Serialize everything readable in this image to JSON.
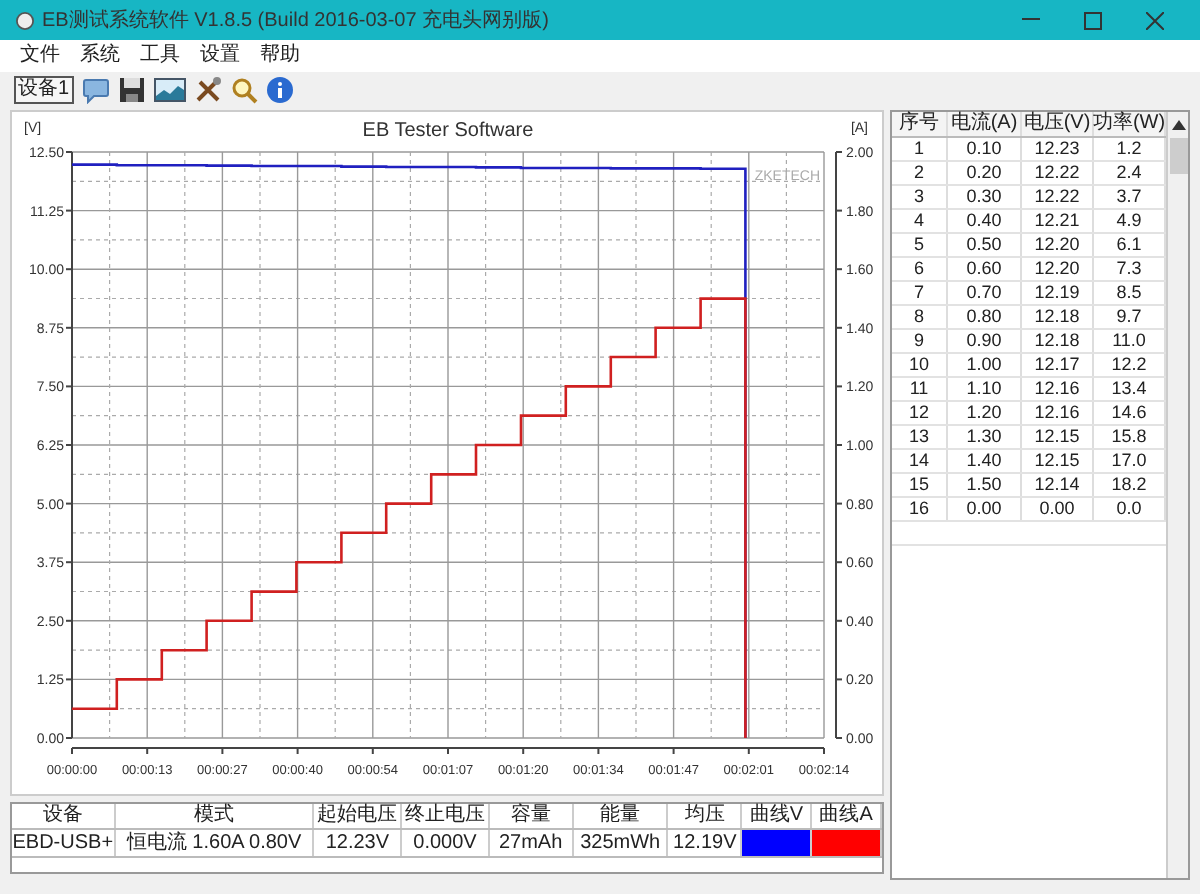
{
  "window": {
    "title": "EB测试系统软件 V1.8.5 (Build 2016-03-07 充电头网别版)"
  },
  "menu": [
    "文件",
    "系统",
    "工具",
    "设置",
    "帮助"
  ],
  "toolbar": {
    "device_button": "设备1"
  },
  "chart": {
    "chart_data": {
      "type": "line",
      "title": "EB Tester Software",
      "ylabel": "[V]",
      "y2label": "[A]",
      "x": [
        0,
        8,
        8,
        16,
        16,
        24,
        24,
        32,
        32,
        40,
        40,
        48,
        48,
        56,
        56,
        64,
        64,
        72,
        72,
        80,
        80,
        88,
        88,
        96,
        96,
        104,
        104,
        112,
        112,
        120,
        120
      ],
      "grid": true,
      "xlim": [
        0,
        134
      ],
      "ylim": [
        0,
        12.5
      ],
      "y2lim": [
        0,
        2
      ],
      "xticks": [
        {
          "value": 0,
          "label": "00:00:00"
        },
        {
          "value": 13.4,
          "label": "00:00:13"
        },
        {
          "value": 26.8,
          "label": "00:00:27"
        },
        {
          "value": 40.2,
          "label": "00:00:40"
        },
        {
          "value": 53.6,
          "label": "00:00:54"
        },
        {
          "value": 67,
          "label": "00:01:07"
        },
        {
          "value": 80.4,
          "label": "00:01:20"
        },
        {
          "value": 93.8,
          "label": "00:01:34"
        },
        {
          "value": 107.2,
          "label": "00:01:47"
        },
        {
          "value": 120.6,
          "label": "00:02:01"
        },
        {
          "value": 134,
          "label": "00:02:14"
        }
      ],
      "yticks": [
        {
          "value": 0,
          "label": "0.00"
        },
        {
          "value": 1.25,
          "label": "1.25"
        },
        {
          "value": 2.5,
          "label": "2.50"
        },
        {
          "value": 3.75,
          "label": "3.75"
        },
        {
          "value": 5,
          "label": "5.00"
        },
        {
          "value": 6.25,
          "label": "6.25"
        },
        {
          "value": 7.5,
          "label": "7.50"
        },
        {
          "value": 8.75,
          "label": "8.75"
        },
        {
          "value": 10,
          "label": "10.00"
        },
        {
          "value": 11.25,
          "label": "11.25"
        },
        {
          "value": 12.5,
          "label": "12.50"
        }
      ],
      "y2ticks": [
        {
          "value": 0,
          "label": "0.00"
        },
        {
          "value": 0.2,
          "label": "0.20"
        },
        {
          "value": 0.4,
          "label": "0.40"
        },
        {
          "value": 0.6,
          "label": "0.60"
        },
        {
          "value": 0.8,
          "label": "0.80"
        },
        {
          "value": 1,
          "label": "1.00"
        },
        {
          "value": 1.2,
          "label": "1.20"
        },
        {
          "value": 1.4,
          "label": "1.40"
        },
        {
          "value": 1.6,
          "label": "1.60"
        },
        {
          "value": 1.8,
          "label": "1.80"
        },
        {
          "value": 2,
          "label": "2.00"
        }
      ],
      "series": [
        {
          "axis": "y",
          "color": "#2020c0",
          "values": [
            12.23,
            12.23,
            12.22,
            12.22,
            12.22,
            12.22,
            12.21,
            12.21,
            12.2,
            12.2,
            12.2,
            12.2,
            12.19,
            12.19,
            12.18,
            12.18,
            12.18,
            12.18,
            12.17,
            12.17,
            12.16,
            12.16,
            12.16,
            12.16,
            12.15,
            12.15,
            12.15,
            12.15,
            12.14,
            12.14,
            0
          ]
        },
        {
          "axis": "y2",
          "color": "#d02020",
          "values": [
            0.1,
            0.1,
            0.2,
            0.2,
            0.3,
            0.3,
            0.4,
            0.4,
            0.5,
            0.5,
            0.6,
            0.6,
            0.7,
            0.7,
            0.8,
            0.8,
            0.9,
            0.9,
            1.0,
            1.0,
            1.1,
            1.1,
            1.2,
            1.2,
            1.3,
            1.3,
            1.4,
            1.4,
            1.5,
            1.5,
            0
          ]
        }
      ],
      "annotations": [
        {
          "text": "ZKETECH"
        }
      ]
    }
  },
  "readings_table": {
    "columns": [
      "序号",
      "电流(A)",
      "电压(V)",
      "功率(W)"
    ],
    "rows": [
      [
        "1",
        "0.10",
        "12.23",
        "1.2"
      ],
      [
        "2",
        "0.20",
        "12.22",
        "2.4"
      ],
      [
        "3",
        "0.30",
        "12.22",
        "3.7"
      ],
      [
        "4",
        "0.40",
        "12.21",
        "4.9"
      ],
      [
        "5",
        "0.50",
        "12.20",
        "6.1"
      ],
      [
        "6",
        "0.60",
        "12.20",
        "7.3"
      ],
      [
        "7",
        "0.70",
        "12.19",
        "8.5"
      ],
      [
        "8",
        "0.80",
        "12.18",
        "9.7"
      ],
      [
        "9",
        "0.90",
        "12.18",
        "11.0"
      ],
      [
        "10",
        "1.00",
        "12.17",
        "12.2"
      ],
      [
        "11",
        "1.10",
        "12.16",
        "13.4"
      ],
      [
        "12",
        "1.20",
        "12.16",
        "14.6"
      ],
      [
        "13",
        "1.30",
        "12.15",
        "15.8"
      ],
      [
        "14",
        "1.40",
        "12.15",
        "17.0"
      ],
      [
        "15",
        "1.50",
        "12.14",
        "18.2"
      ],
      [
        "16",
        "0.00",
        "0.00",
        "0.0"
      ]
    ]
  },
  "summary_table": {
    "columns": [
      "设备",
      "模式",
      "起始电压",
      "终止电压",
      "容量",
      "能量",
      "均压",
      "曲线V",
      "曲线A"
    ],
    "rows": [
      {
        "cells": [
          "EBD-USB+",
          "恒电流 1.60A 0.80V",
          "12.23V",
          "0.000V",
          "27mAh",
          "325mWh",
          "12.19V"
        ],
        "curve_v": {
          "color": "#0000ff"
        },
        "curve_a": {
          "color": "#ff0000"
        }
      }
    ]
  }
}
